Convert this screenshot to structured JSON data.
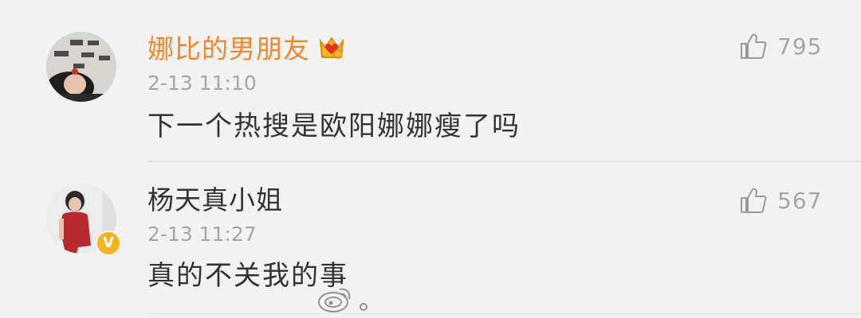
{
  "comments": [
    {
      "username": "娜比的男朋友",
      "timestamp": "2-13 11:10",
      "text": "下一个热搜是欧阳娜娜瘦了吗",
      "likes": "795",
      "username_color": "#f0882b",
      "badge": "crown-icon"
    },
    {
      "username": "杨天真小姐",
      "timestamp": "2-13 11:27",
      "text": "真的不关我的事",
      "likes": "567",
      "username_color": "#333333",
      "badge": "verified-badge",
      "badge_glyph": "V"
    }
  ],
  "colors": {
    "background": "#f2f2f2",
    "muted": "#a6a6a6",
    "text": "#333333",
    "vip_orange": "#f0882b",
    "verified_yellow": "#f6b31c"
  }
}
